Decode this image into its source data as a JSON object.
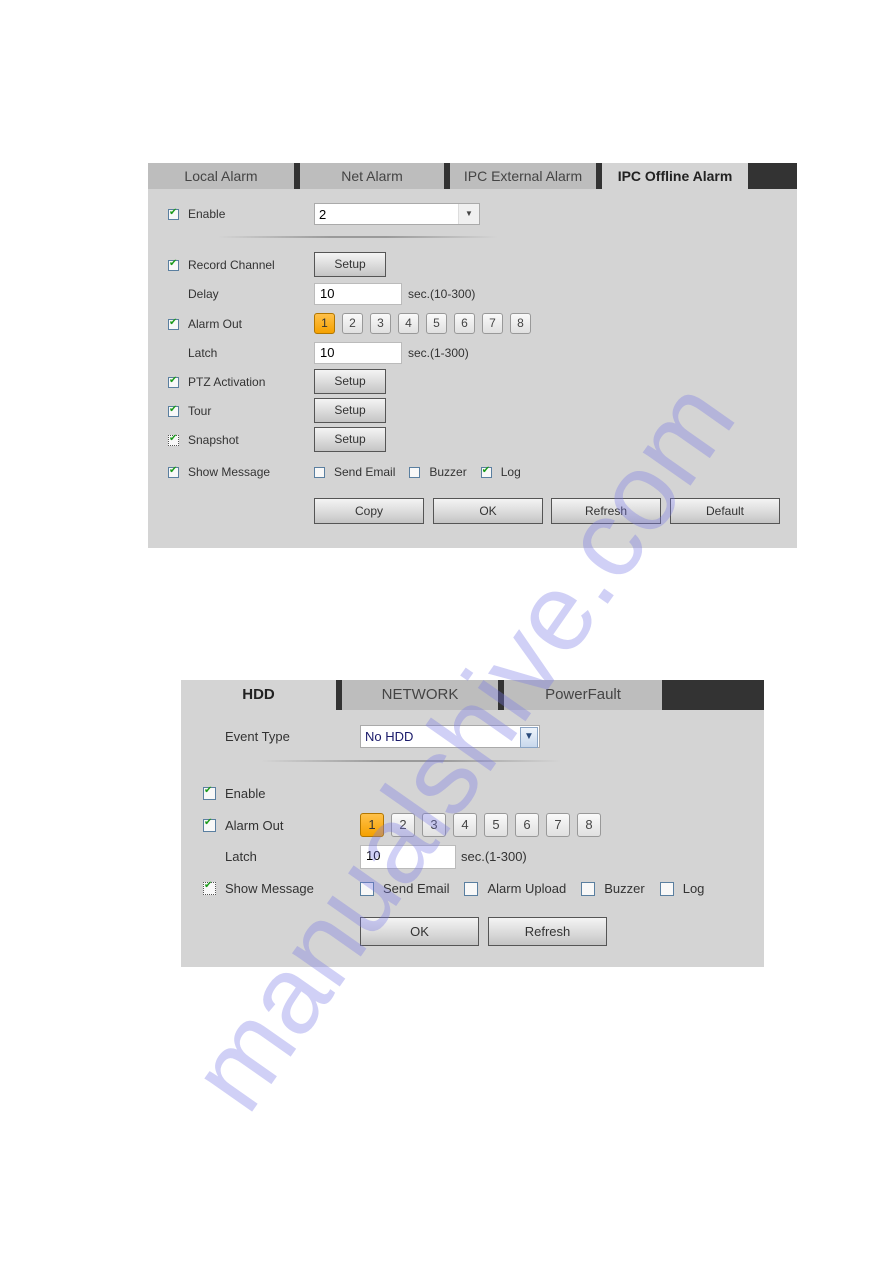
{
  "panel1": {
    "tabs": [
      {
        "label": "Local Alarm",
        "active": false
      },
      {
        "label": "Net Alarm",
        "active": false
      },
      {
        "label": "IPC External Alarm",
        "active": false
      },
      {
        "label": "IPC Offline Alarm",
        "active": true
      }
    ],
    "enable": {
      "label": "Enable",
      "checked": true,
      "channel_value": "2"
    },
    "record_channel": {
      "label": "Record Channel",
      "checked": true,
      "button": "Setup"
    },
    "delay": {
      "label": "Delay",
      "value": "10",
      "unit": "sec.(10-300)"
    },
    "alarm_out": {
      "label": "Alarm Out",
      "checked": true,
      "channels": [
        "1",
        "2",
        "3",
        "4",
        "5",
        "6",
        "7",
        "8"
      ],
      "selected": [
        "1"
      ]
    },
    "latch": {
      "label": "Latch",
      "value": "10",
      "unit": "sec.(1-300)"
    },
    "ptz_activation": {
      "label": "PTZ Activation",
      "checked": true,
      "button": "Setup"
    },
    "tour": {
      "label": "Tour",
      "checked": true,
      "button": "Setup"
    },
    "snapshot": {
      "label": "Snapshot",
      "checked": true,
      "button": "Setup"
    },
    "show_message": {
      "label": "Show Message",
      "checked": true
    },
    "send_email": {
      "label": "Send Email",
      "checked": false
    },
    "buzzer": {
      "label": "Buzzer",
      "checked": false
    },
    "log": {
      "label": "Log",
      "checked": true
    },
    "buttons": {
      "copy": "Copy",
      "ok": "OK",
      "refresh": "Refresh",
      "default": "Default"
    }
  },
  "panel2": {
    "tabs": [
      {
        "label": "HDD",
        "active": true
      },
      {
        "label": "NETWORK",
        "active": false
      },
      {
        "label": "PowerFault",
        "active": false
      }
    ],
    "event_type": {
      "label": "Event Type",
      "value": "No HDD"
    },
    "enable": {
      "label": "Enable",
      "checked": true
    },
    "alarm_out": {
      "label": "Alarm Out",
      "checked": true,
      "channels": [
        "1",
        "2",
        "3",
        "4",
        "5",
        "6",
        "7",
        "8"
      ],
      "selected": [
        "1"
      ]
    },
    "latch": {
      "label": "Latch",
      "value": "10",
      "unit": "sec.(1-300)"
    },
    "show_message": {
      "label": "Show Message",
      "checked": true
    },
    "send_email": {
      "label": "Send Email",
      "checked": false
    },
    "alarm_upload": {
      "label": "Alarm Upload",
      "checked": false
    },
    "buzzer": {
      "label": "Buzzer",
      "checked": false
    },
    "log": {
      "label": "Log",
      "checked": false
    },
    "buttons": {
      "ok": "OK",
      "refresh": "Refresh"
    }
  },
  "watermark": "manualshive.com",
  "colors": {
    "panel_bg": "#d4d4d4",
    "tab_bar": "#333333",
    "selected_channel": "#f5a100",
    "check_green": "#1b9a1b"
  }
}
